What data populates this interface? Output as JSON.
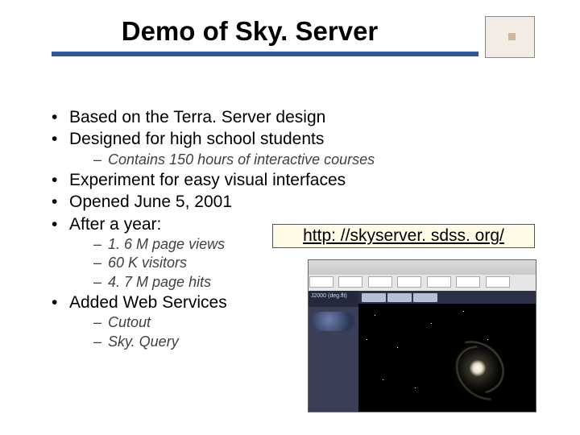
{
  "title": "Demo of Sky. Server",
  "link_url": "http: //skyserver. sdss. org/",
  "bullets": {
    "b1": "Based on the Terra. Server design",
    "b2": "Designed for high school students",
    "b2_sub1": "Contains 150 hours of interactive courses",
    "b3": "Experiment for easy visual interfaces",
    "b4": "Opened June 5, 2001",
    "b5": "After a year:",
    "b5_sub1": "1. 6 M page views",
    "b5_sub2": "60 K visitors",
    "b5_sub3": "4. 7 M page hits",
    "b6": "Added Web Services",
    "b6_sub1": "Cutout",
    "b6_sub2": "Sky. Query"
  },
  "thumb": {
    "side_header": "J2000 (deg.flt)"
  }
}
